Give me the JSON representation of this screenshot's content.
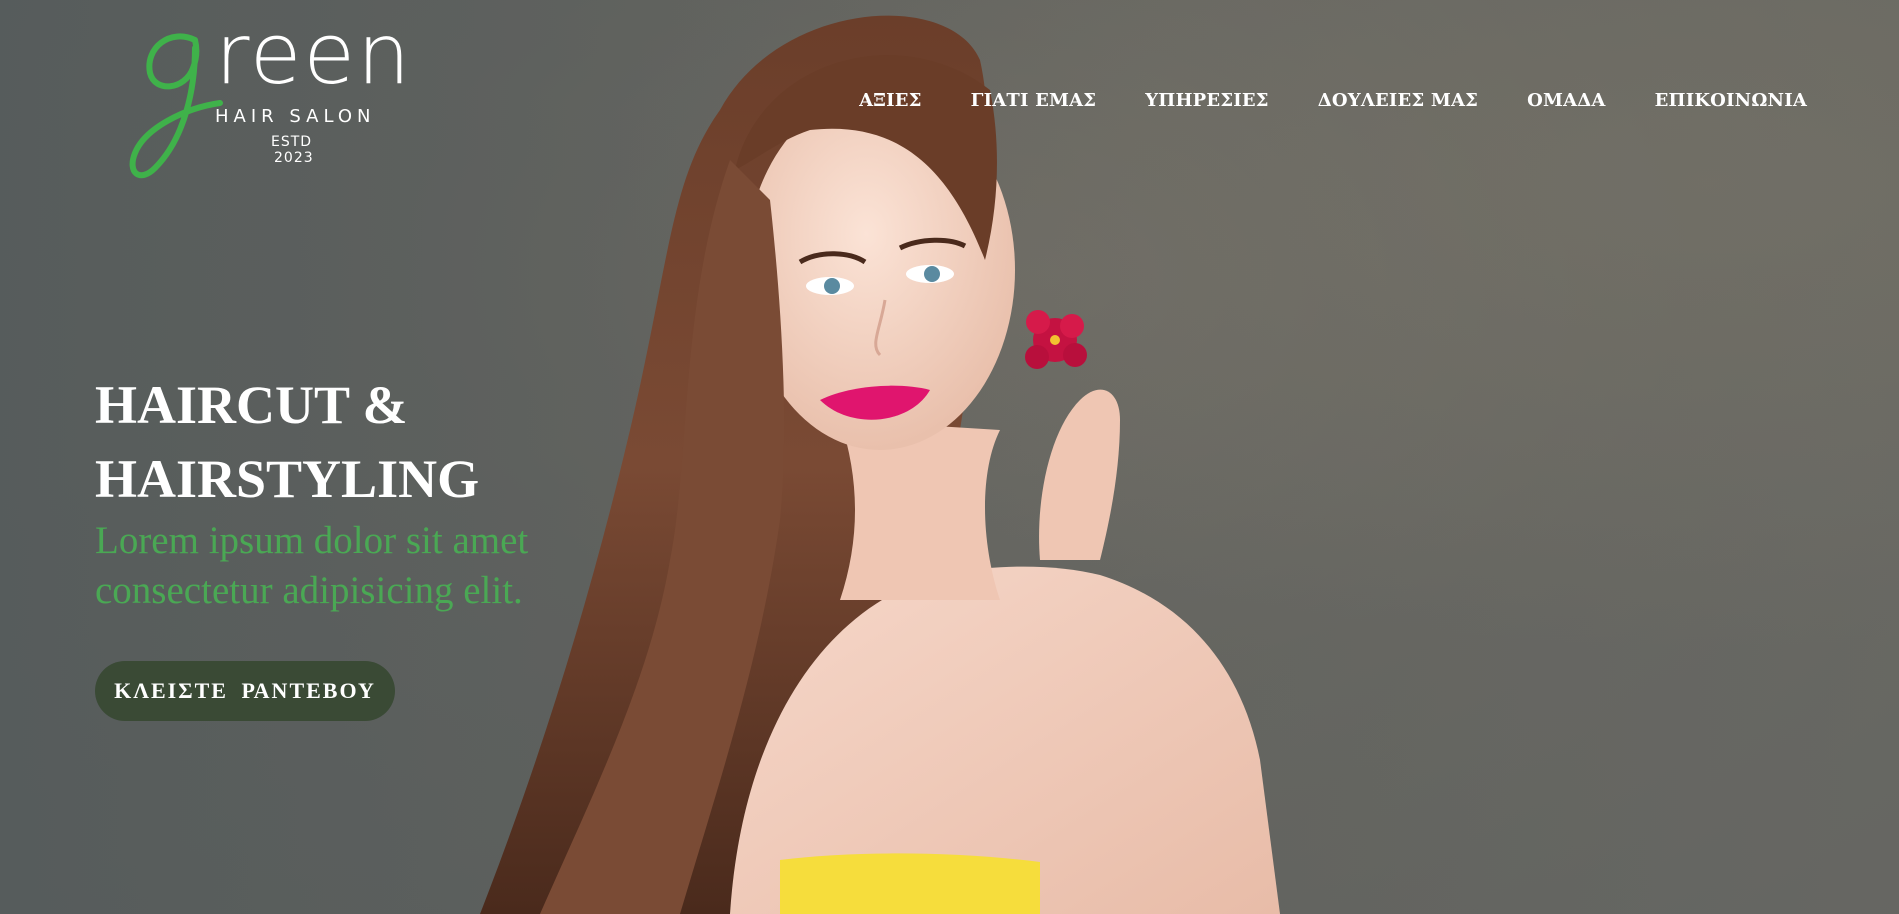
{
  "brand": {
    "logo_word": "reen",
    "logo_sub": "HAIR SALON",
    "logo_estd": "ESTD",
    "logo_year": "2023",
    "green": "#3fb24a"
  },
  "nav": {
    "items": [
      {
        "label": "ΑΞΙΕΣ"
      },
      {
        "label": "ΓΙΑΤΙ ΕΜΑΣ"
      },
      {
        "label": "ΥΠΗΡΕΣΙΕΣ"
      },
      {
        "label": "ΔΟΥΛΕΙΕΣ ΜΑΣ"
      },
      {
        "label": "ΟΜΑΔΑ"
      },
      {
        "label": "ΕΠΙΚΟΙΝΩΝΙΑ"
      }
    ]
  },
  "hero": {
    "title_line1": "HAIRCUT &",
    "title_line2": "HAIRSTYLING",
    "subtitle_line1": "Lorem ipsum dolor sit amet",
    "subtitle_line2": "consectetur adipisicing elit.",
    "cta_label": "ΚΛΕΙΣΤΕ ΡΑΝΤΕΒΟΥ",
    "accent": "#4aa854",
    "button_color": "#3a4a35"
  }
}
